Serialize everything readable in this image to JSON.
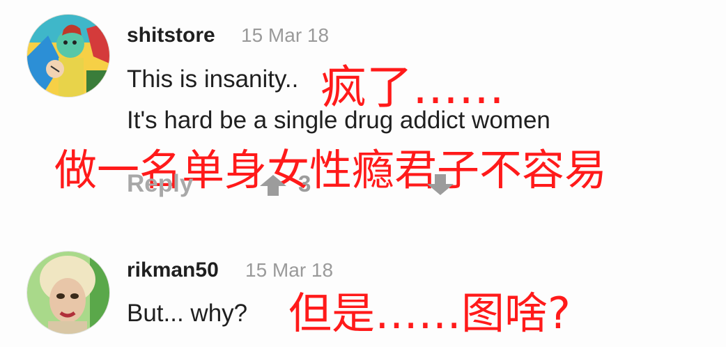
{
  "comments": [
    {
      "username": "shitstore",
      "date": "15 Mar 18",
      "lines": [
        "This is insanity..",
        "It's hard be a single drug addict women"
      ],
      "reply_label": "Reply",
      "upvotes": "3",
      "avatar_icon": "cartoon-avatar-icon"
    },
    {
      "username": "rikman50",
      "date": "15 Mar 18",
      "lines": [
        "But... why?"
      ],
      "avatar_icon": "photo-avatar-icon"
    }
  ],
  "annotations": {
    "crazy": "疯了……",
    "single_woman": "做一名单身女性瘾君子不容易",
    "but_why": "但是……图啥?"
  },
  "colors": {
    "annotation_red": "#ff1a1a",
    "muted_gray": "#a8a8a8"
  }
}
